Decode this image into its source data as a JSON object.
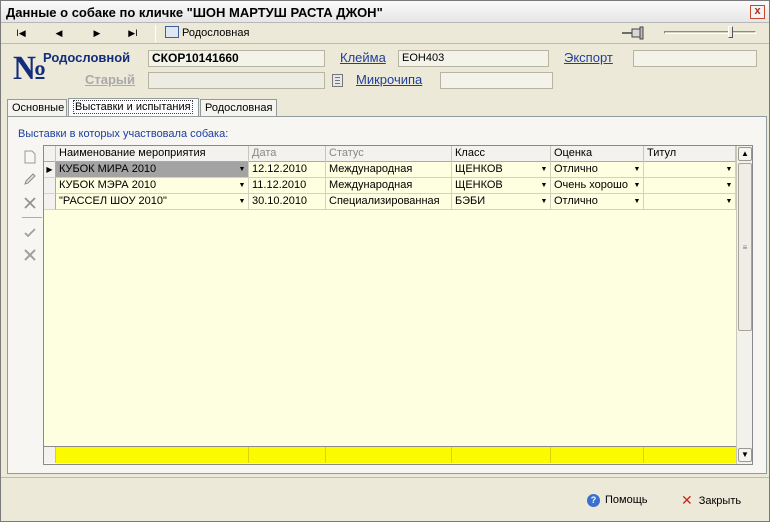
{
  "window": {
    "title": "Данные о собаке по кличке \"ШОН МАРТУШ РАСТА ДЖОН\"",
    "close_glyph": "x"
  },
  "toolbar": {
    "first_glyph": "I◀",
    "prev_glyph": "◀",
    "next_glyph": "▶",
    "last_glyph": "▶I",
    "pedigree_label": "Родословная",
    "slider_level": 0.72
  },
  "info": {
    "numero_glyph": "№",
    "pedigree_label": "Родословной",
    "pedigree_value": "СКОР10141660",
    "old_label": "Старый",
    "old_value": "",
    "brand_label": "Клейма",
    "brand_value": "ЕОН403",
    "microchip_label": "Микрочипа",
    "microchip_value": "",
    "export_label": "Экспорт",
    "export_value": ""
  },
  "tabs": [
    {
      "label": "Основные"
    },
    {
      "label": "Выставки и испытания"
    },
    {
      "label": "Родословная"
    }
  ],
  "shows": {
    "caption": "Выставки в которых участвовала собака:",
    "columns": [
      "Наименование мероприятия",
      "Дата",
      "Статус",
      "Класс",
      "Оценка",
      "Титул"
    ],
    "rows": [
      {
        "event": "КУБОК МИРА 2010",
        "date": "12.12.2010",
        "status": "Международная",
        "class": "ЩЕНКОВ",
        "grade": "Отлично",
        "title": ""
      },
      {
        "event": "КУБОК МЭРА 2010",
        "date": "11.12.2010",
        "status": "Международная",
        "class": "ЩЕНКОВ",
        "grade": "Очень хорошо",
        "title": ""
      },
      {
        "event": "\"РАССЕЛ ШОУ 2010\"",
        "date": "30.10.2010",
        "status": "Специализированная",
        "class": "БЭБИ",
        "grade": "Отлично",
        "title": ""
      }
    ]
  },
  "footer": {
    "help_label": "Помощь",
    "close_label": "Закрыть"
  }
}
